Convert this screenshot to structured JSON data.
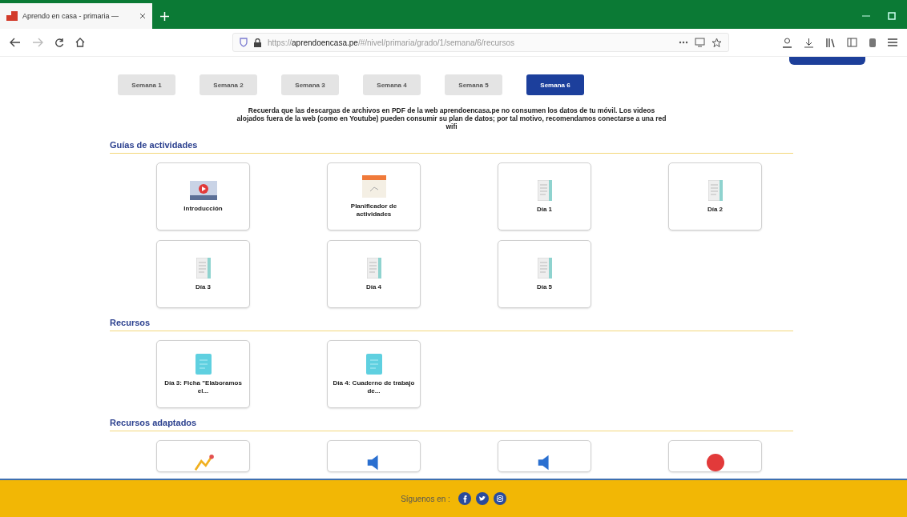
{
  "browser": {
    "tab_title": "Aprendo en casa - primaria — ",
    "url_prefix": "https://",
    "url_domain": "aprendoencasa.pe",
    "url_path": "/#/nivel/primaria/grado/1/semana/6/recursos"
  },
  "weeks": [
    {
      "label": "Semana 1",
      "selected": false
    },
    {
      "label": "Semana 2",
      "selected": false
    },
    {
      "label": "Semana 3",
      "selected": false
    },
    {
      "label": "Semana 4",
      "selected": false
    },
    {
      "label": "Semana 5",
      "selected": false
    },
    {
      "label": "Semana 6",
      "selected": true
    }
  ],
  "notice": "Recuerda que las descargas de archivos en PDF de la web aprendoencasa.pe no consumen los datos de tu móvil. Los videos alojados fuera de la web (como en Youtube) pueden consumir su plan de datos; por tal motivo, recomendamos conectarse a una red wifi",
  "sections": [
    {
      "title": "Guías de actividades",
      "cards": [
        {
          "kind": "video",
          "label": "Introducción"
        },
        {
          "kind": "calendar",
          "label": "Planificador de actividades"
        },
        {
          "kind": "document",
          "label": "Día 1"
        },
        {
          "kind": "document",
          "label": "Día 2"
        },
        {
          "kind": "document",
          "label": "Día 3"
        },
        {
          "kind": "document",
          "label": "Día 4"
        },
        {
          "kind": "document",
          "label": "Día 5"
        }
      ]
    },
    {
      "title": "Recursos",
      "cards": [
        {
          "kind": "sheet",
          "label": "Día 3: Ficha \"Elaboramos el..."
        },
        {
          "kind": "sheet",
          "label": "Día 4: Cuaderno de trabajo de..."
        }
      ]
    },
    {
      "title": "Recursos adaptados",
      "cards": [
        {
          "kind": "chart"
        },
        {
          "kind": "audio"
        },
        {
          "kind": "audio"
        },
        {
          "kind": "video"
        }
      ]
    }
  ],
  "footer": {
    "label": "Síguenos en :",
    "social": [
      {
        "kind": "facebook"
      },
      {
        "kind": "twitter"
      },
      {
        "kind": "instagram"
      }
    ]
  }
}
